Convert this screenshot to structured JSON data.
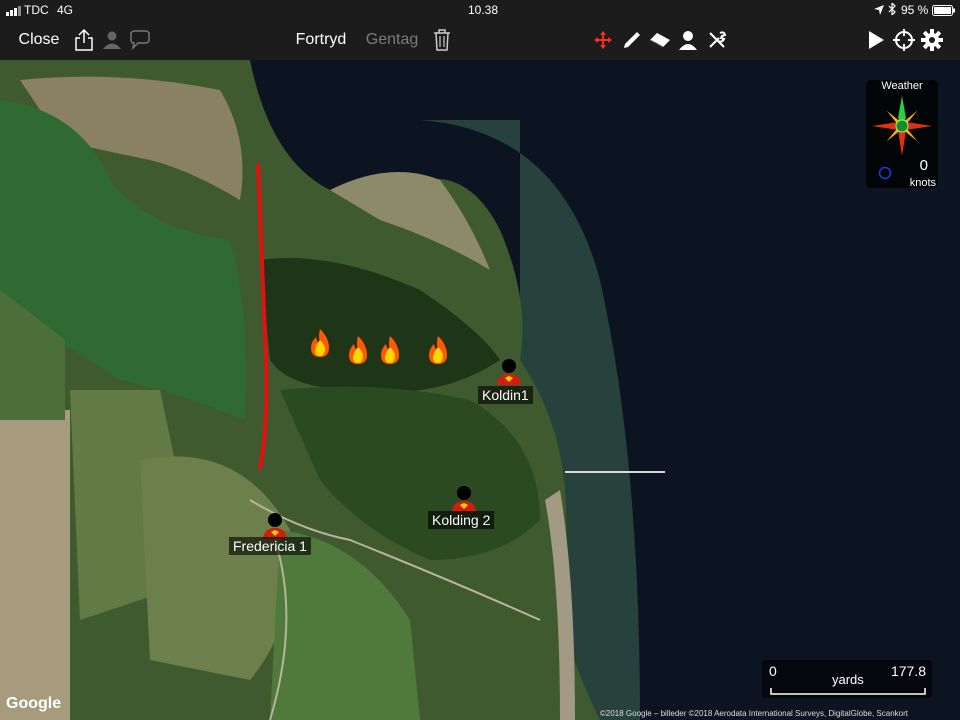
{
  "status": {
    "carrier": "TDC",
    "network": "4G",
    "time": "10.38",
    "battery": "95 %"
  },
  "toolbar": {
    "close_label": "Close",
    "undo_label": "Fortryd",
    "redo_label": "Gentag",
    "icons": [
      "share-icon",
      "user-silhouette-icon",
      "chat-icon",
      "trash-icon",
      "move-cross-icon",
      "pencil-icon",
      "eraser-icon",
      "person-icon",
      "wrench-icon",
      "play-icon",
      "crosshair-icon",
      "gear-icon"
    ],
    "accent": "#ff2a1a"
  },
  "markers": [
    {
      "label": "Koldin1"
    },
    {
      "label": "Kolding 2"
    },
    {
      "label": "Fredericia 1"
    }
  ],
  "fires_count": 4,
  "weather": {
    "title": "Weather",
    "speed": "0",
    "unit": "knots"
  },
  "scale": {
    "min": "0",
    "unit": "yards",
    "max": "177.8"
  },
  "attribution": {
    "logo": "Google",
    "copyright": "©2018 Google – billeder ©2018 Aerodata International Surveys, DigitalGlobe, Scankort"
  },
  "colors": {
    "water": "#0b1420",
    "line": "#e21010",
    "marker_body": "#d01f10"
  }
}
